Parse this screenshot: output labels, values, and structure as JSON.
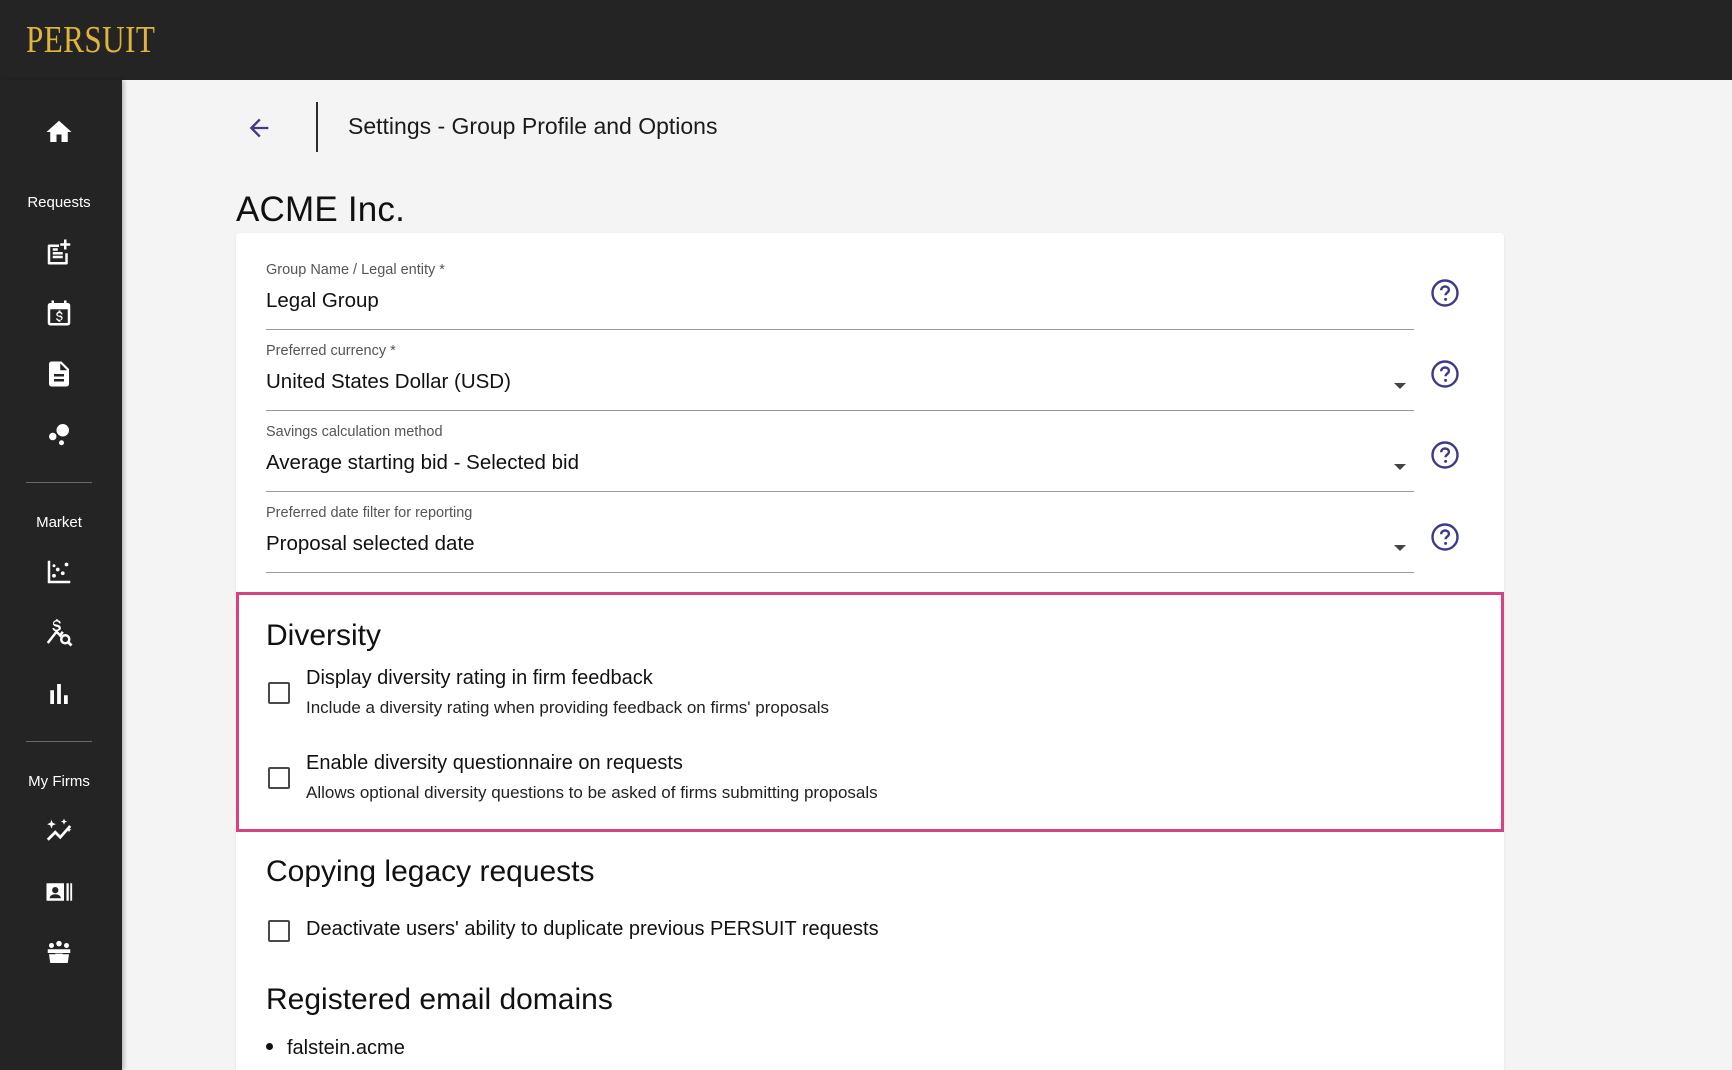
{
  "brand": {
    "logo_text": "PERSUIT",
    "logo_color": "#e0b33c"
  },
  "sidebar": {
    "home_icon": "home-icon",
    "sections": [
      {
        "label": "Requests",
        "items": [
          "new-request-icon",
          "calendar-dollar-icon",
          "document-icon",
          "bubbles-icon"
        ]
      },
      {
        "label": "Market",
        "items": [
          "scatter-chart-icon",
          "price-search-icon",
          "bar-chart-icon"
        ]
      },
      {
        "label": "My Firms",
        "items": [
          "sparkle-chart-icon",
          "contact-card-icon",
          "group-icon"
        ]
      }
    ]
  },
  "header": {
    "back_icon": "arrow-back-icon",
    "title": "Settings - Group Profile and Options"
  },
  "org_name": "ACME Inc.",
  "fields": [
    {
      "label": "Group Name / Legal entity *",
      "value": "Legal Group",
      "type": "text"
    },
    {
      "label": "Preferred currency *",
      "value": "United States Dollar (USD)",
      "type": "select"
    },
    {
      "label": "Savings calculation method",
      "value": "Average starting bid - Selected bid",
      "type": "select"
    },
    {
      "label": "Preferred date filter for reporting",
      "value": "Proposal selected date",
      "type": "select"
    }
  ],
  "diversity": {
    "title": "Diversity",
    "highlight_color": "#d8427f",
    "options": [
      {
        "label": "Display diversity rating in firm feedback",
        "description": "Include a diversity rating when providing feedback on firms' proposals",
        "checked": false
      },
      {
        "label": "Enable diversity questionnaire on requests",
        "description": "Allows optional diversity questions to be asked of firms submitting proposals",
        "checked": false
      }
    ]
  },
  "legacy": {
    "title": "Copying legacy requests",
    "option": {
      "label": "Deactivate users' ability to duplicate previous PERSUIT requests",
      "checked": false
    }
  },
  "domains": {
    "title": "Registered email domains",
    "items": [
      "falstein.acme"
    ]
  },
  "colors": {
    "accent": "#3d3a8c",
    "topbar": "#242424",
    "background": "#f4f4f4"
  }
}
